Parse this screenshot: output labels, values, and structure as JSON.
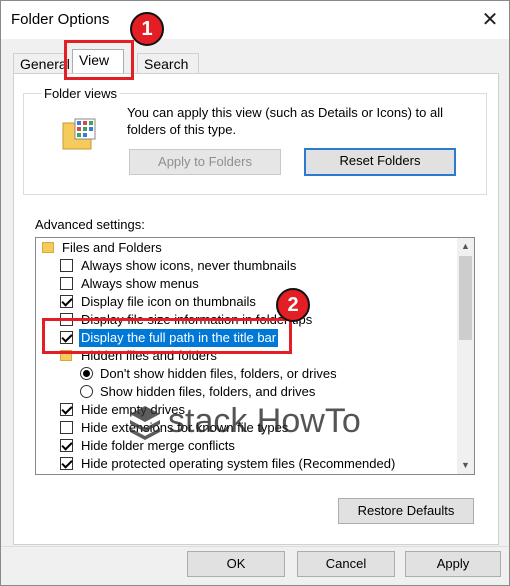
{
  "window": {
    "title": "Folder Options"
  },
  "tabs": [
    {
      "label": "General"
    },
    {
      "label": "View"
    },
    {
      "label": "Search"
    }
  ],
  "folder_views": {
    "title": "Folder views",
    "description_line1": "You can apply this view (such as Details or Icons) to all",
    "description_line2": "folders of this type.",
    "apply_label": "Apply to Folders",
    "reset_label": "Reset Folders"
  },
  "advanced": {
    "label": "Advanced settings:",
    "items": [
      {
        "type": "folder",
        "label": "Files and Folders"
      },
      {
        "type": "checkbox",
        "checked": false,
        "label": "Always show icons, never thumbnails"
      },
      {
        "type": "checkbox",
        "checked": false,
        "label": "Always show menus"
      },
      {
        "type": "checkbox",
        "checked": true,
        "label": "Display file icon on thumbnails"
      },
      {
        "type": "checkbox",
        "checked": false,
        "label": "Display file size information in folder tips"
      },
      {
        "type": "checkbox",
        "checked": true,
        "label": "Display the full path in the title bar",
        "selected": true
      },
      {
        "type": "folder",
        "label": "Hidden files and folders"
      },
      {
        "type": "radio",
        "checked": true,
        "label": "Don't show hidden files, folders, or drives"
      },
      {
        "type": "radio",
        "checked": false,
        "label": "Show hidden files, folders, and drives"
      },
      {
        "type": "checkbox",
        "checked": true,
        "label": "Hide empty drives"
      },
      {
        "type": "checkbox",
        "checked": false,
        "label": "Hide extensions for known file types"
      },
      {
        "type": "checkbox",
        "checked": true,
        "label": "Hide folder merge conflicts"
      },
      {
        "type": "checkbox",
        "checked": true,
        "label": "Hide protected operating system files (Recommended)"
      }
    ],
    "restore_label": "Restore Defaults"
  },
  "footer": {
    "ok": "OK",
    "cancel": "Cancel",
    "apply": "Apply"
  },
  "annotations": {
    "marker1": "1",
    "marker2": "2",
    "watermark": "stack HowTo"
  },
  "colors": {
    "selection": "#0078d7",
    "annotation_red": "#e31e25"
  }
}
